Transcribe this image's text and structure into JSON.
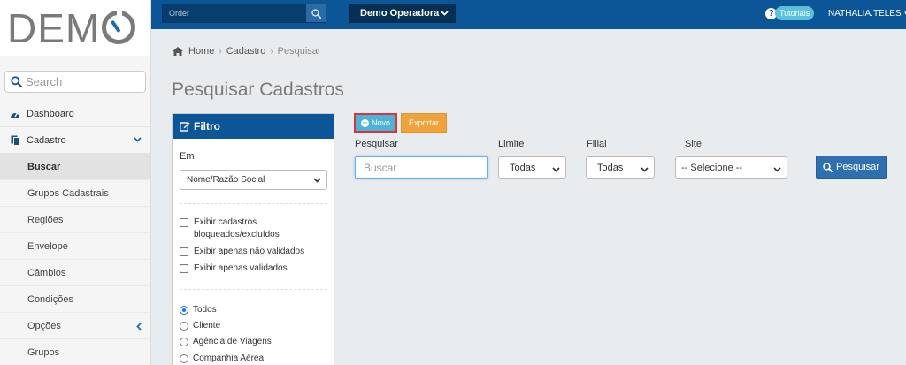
{
  "logo": {
    "text_pre": "DEM"
  },
  "sidebar": {
    "search_placeholder": "Search",
    "items": [
      {
        "label": "Dashboard"
      },
      {
        "label": "Cadastro"
      }
    ],
    "subitems": [
      {
        "label": "Buscar"
      },
      {
        "label": "Grupos Cadastrais"
      },
      {
        "label": "Regiões"
      },
      {
        "label": "Envelope"
      },
      {
        "label": "Câmbios"
      },
      {
        "label": "Condições"
      },
      {
        "label": "Opções"
      },
      {
        "label": "Grupos"
      }
    ]
  },
  "topbar": {
    "order_placeholder": "Order",
    "operadora": "Demo Operadora",
    "tutoriais": "Tutoriais",
    "user": "NATHALIA.TELES"
  },
  "breadcrumb": {
    "home": "Home",
    "cadastro": "Cadastro",
    "current": "Pesquisar"
  },
  "page_title": "Pesquisar Cadastros",
  "filter": {
    "title": "Filtro",
    "em_label": "Em",
    "em_value": "Nome/Razão Social",
    "checks": [
      {
        "line1": "Exibir cadastros",
        "line2": "bloqueados/excluídos"
      },
      {
        "line1": "Exibir apenas não validados",
        "line2": ""
      },
      {
        "line1": "Exibir apenas validados.",
        "line2": ""
      }
    ],
    "radios": [
      {
        "label": "Todos",
        "checked": true
      },
      {
        "label": "Cliente",
        "checked": false
      },
      {
        "label": "Agência de Viagens",
        "checked": false
      },
      {
        "label": "Companhia Aérea",
        "checked": false
      }
    ]
  },
  "actions": {
    "novo": "Novo",
    "exportar": "Exportar"
  },
  "form": {
    "pesquisar_label": "Pesquisar",
    "buscar_placeholder": "Buscar",
    "limite_label": "Limite",
    "limite_value": "Todas",
    "filial_label": "Filial",
    "filial_value": "Todas",
    "site_label": "Site",
    "site_value": "-- Selecione --",
    "pesquisar_button": "Pesquisar"
  },
  "colors": {
    "primary": "#0c5697",
    "novo": "#4cb3d9",
    "exportar": "#f0a33a",
    "highlight": "#d9343b"
  }
}
